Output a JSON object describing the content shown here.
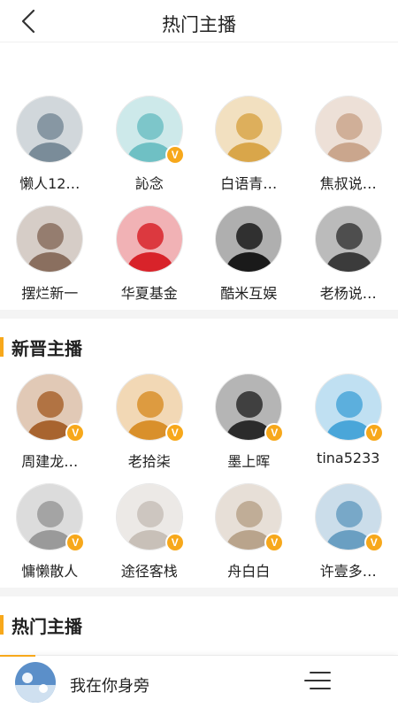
{
  "header": {
    "title": "热门主播",
    "back_icon": "back-chevron-icon"
  },
  "hot_anchors": [
    {
      "name": "懒人12…",
      "verified": false,
      "avatar_color": "#7a8c99"
    },
    {
      "name": "訫念",
      "verified": true,
      "avatar_color": "#6fc0c4"
    },
    {
      "name": "白语青…",
      "verified": false,
      "avatar_color": "#d9a64a"
    },
    {
      "name": "焦叔说…",
      "verified": false,
      "avatar_color": "#caa68d"
    },
    {
      "name": "摆烂新一",
      "verified": false,
      "avatar_color": "#8a6f5f"
    },
    {
      "name": "华夏基金",
      "verified": false,
      "avatar_color": "#d8232a"
    },
    {
      "name": "酷米互娱",
      "verified": false,
      "avatar_color": "#1a1a1a"
    },
    {
      "name": "老杨说…",
      "verified": false,
      "avatar_color": "#3b3b3b"
    }
  ],
  "new_section": {
    "title": "新晋主播",
    "anchors": [
      {
        "name": "周建龙…",
        "verified": true,
        "avatar_color": "#a8642f"
      },
      {
        "name": "老拾柒",
        "verified": true,
        "avatar_color": "#d9902b"
      },
      {
        "name": "墨上晖",
        "verified": true,
        "avatar_color": "#2b2b2b"
      },
      {
        "name": "tina5233",
        "verified": true,
        "avatar_color": "#4aa6d9"
      },
      {
        "name": "慵懒散人",
        "verified": true,
        "avatar_color": "#9a9a9a"
      },
      {
        "name": "途径客栈",
        "verified": true,
        "avatar_color": "#c8c0b8"
      },
      {
        "name": "舟白白",
        "verified": true,
        "avatar_color": "#b9a48c"
      },
      {
        "name": "许壹多…",
        "verified": true,
        "avatar_color": "#6a9fc2"
      }
    ]
  },
  "hot_section": {
    "title": "热门主播"
  },
  "player": {
    "title": "我在你身旁",
    "playlist_icon": "playlist-menu-icon",
    "accent_color": "#f7a81b"
  },
  "colors": {
    "accent": "#f7a81b",
    "divider": "#f4f4f4",
    "text": "#222222"
  }
}
